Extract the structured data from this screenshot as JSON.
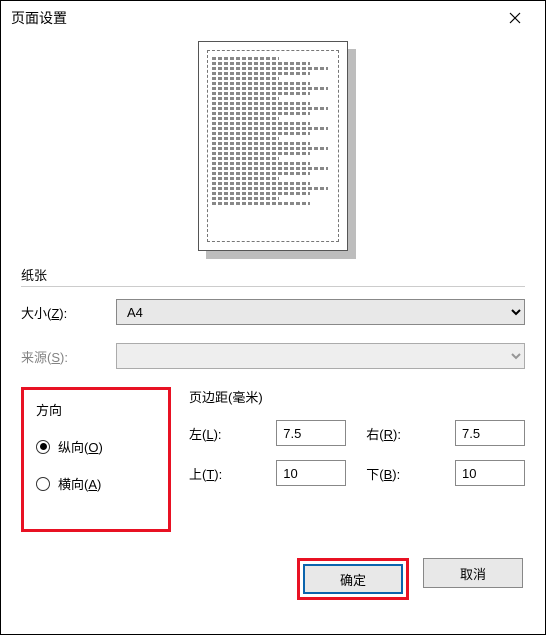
{
  "title": "页面设置",
  "paper": {
    "group_label": "纸张",
    "size_label": "大小(Z):",
    "size_value": "A4",
    "source_label": "来源(S):",
    "source_value": ""
  },
  "orientation": {
    "group_label": "方向",
    "portrait_label": "纵向(O)",
    "landscape_label": "横向(A)",
    "selected": "portrait"
  },
  "margins": {
    "group_label": "页边距(毫米)",
    "left_label": "左(L):",
    "right_label": "右(R):",
    "top_label": "上(T):",
    "bottom_label": "下(B):",
    "left": "7.5",
    "right": "7.5",
    "top": "10",
    "bottom": "10"
  },
  "buttons": {
    "ok": "确定",
    "cancel": "取消"
  }
}
